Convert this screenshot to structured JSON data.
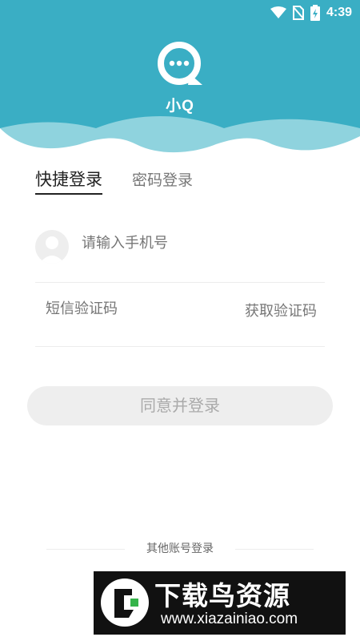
{
  "status_bar": {
    "time": "4:39",
    "icons": [
      "wifi-icon",
      "no-sim-icon",
      "battery-charging-icon"
    ]
  },
  "app": {
    "name": "小Q",
    "logo_icon": "chat-bubble-logo-icon"
  },
  "colors": {
    "header_bg": "#3aaec4",
    "wave": "#8fd3de",
    "login_button_bg": "#eeeeee"
  },
  "tabs": [
    {
      "label": "快捷登录",
      "active": true
    },
    {
      "label": "密码登录",
      "active": false
    }
  ],
  "form": {
    "phone_placeholder": "请输入手机号",
    "code_placeholder": "短信验证码",
    "get_code_label": "获取验证码",
    "submit_label": "同意并登录"
  },
  "other_login": {
    "label": "其他账号登录"
  },
  "watermark": {
    "title": "下载鸟资源",
    "url": "www.xiazainiao.com"
  }
}
